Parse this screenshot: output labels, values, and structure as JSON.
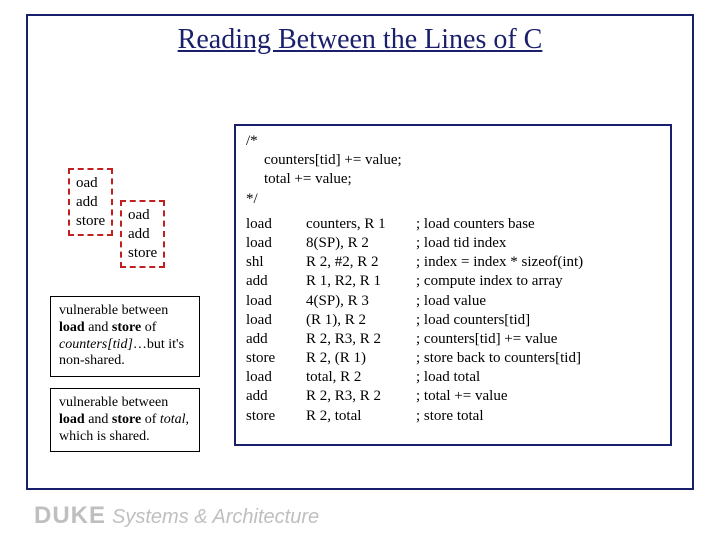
{
  "title": "Reading Between the Lines of C",
  "thread1": {
    "l1": "oad",
    "l2": "add",
    "l3": "store"
  },
  "thread2": {
    "l1": "oad",
    "l2": "add",
    "l3": "store"
  },
  "caption1": {
    "p1": "vulnerable between ",
    "p2": "load",
    "p3": " and ",
    "p4": "store",
    "p5": " of ",
    "p6": "counters[tid]",
    "p7": "…but it's non-shared."
  },
  "caption2": {
    "p1": "vulnerable between ",
    "p2": "load",
    "p3": " and ",
    "p4": "store",
    "p5": " of ",
    "p6": "total",
    "p7": ", which is shared."
  },
  "comment": {
    "l1": "/*",
    "l2": "counters[tid] += value;",
    "l3": "total += value;",
    "l4": "*/"
  },
  "code": {
    "op": [
      "load",
      "load",
      "shl",
      "add",
      "load",
      "load",
      "add",
      "store",
      "load",
      "add",
      "store"
    ],
    "args": [
      "counters, R 1",
      "8(SP), R 2",
      "R 2, #2, R 2",
      "R 1, R2, R 1",
      "4(SP), R 3",
      "(R 1), R 2",
      "R 2, R3, R 2",
      "R 2, (R 1)",
      "total, R 2",
      "R 2, R3, R 2",
      "R 2, total"
    ],
    "cmt": [
      "; load counters base",
      "; load tid index",
      "; index = index * sizeof(int)",
      "; compute index to array",
      "; load value",
      "; load counters[tid]",
      "; counters[tid] += value",
      "; store back to counters[tid]",
      "; load total",
      "; total += value",
      "; store total"
    ]
  },
  "footer": {
    "duke": "DUKE",
    "rest": "Systems & Architecture"
  }
}
